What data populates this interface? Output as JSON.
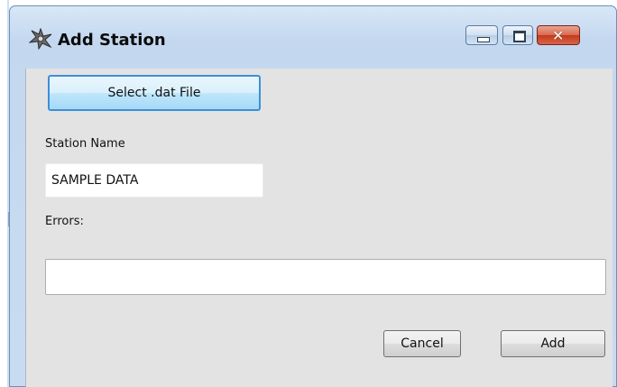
{
  "window": {
    "title": "Add Station",
    "icon": "station-gear-icon",
    "controls": [
      "minimize-icon",
      "maximize-icon",
      "close-icon"
    ]
  },
  "form": {
    "select_button_label": "Select .dat File",
    "station_name_label": "Station Name",
    "station_name_value": "SAMPLE DATA",
    "errors_label": "Errors:",
    "errors_value": ""
  },
  "actions": {
    "cancel_label": "Cancel",
    "add_label": "Add"
  },
  "colors": {
    "titlebar": "#c8dcf1",
    "client_bg": "#e3e3e3",
    "focus_border": "#3c8fd9",
    "close_red": "#c23a18"
  }
}
